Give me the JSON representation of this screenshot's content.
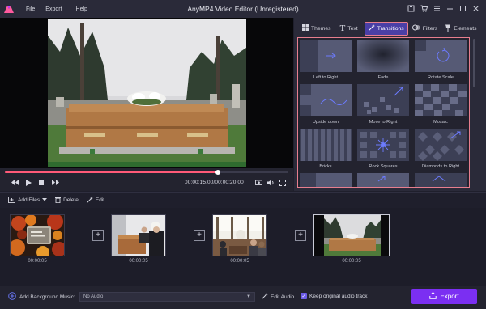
{
  "app": {
    "title": "AnyMP4 Video Editor (Unregistered)",
    "menu": [
      "File",
      "Export",
      "Help"
    ],
    "accent": "#7b2ff2",
    "highlight": "#e87e8e"
  },
  "player": {
    "progress": 0.75,
    "time_current": "00:00:15.00",
    "time_total": "00:00:20.00"
  },
  "tabs": [
    {
      "label": "Themes",
      "icon": "themes-grid-icon"
    },
    {
      "label": "Text",
      "icon": "text-t-icon"
    },
    {
      "label": "Transitions",
      "icon": "transitions-wand-icon",
      "active": true
    },
    {
      "label": "Filters",
      "icon": "filters-circles-icon"
    },
    {
      "label": "Elements",
      "icon": "elements-pin-icon"
    }
  ],
  "transitions": [
    {
      "label": "Left to Right"
    },
    {
      "label": "Fade"
    },
    {
      "label": "Rotate Scale"
    },
    {
      "label": "Upside down"
    },
    {
      "label": "Move to Right"
    },
    {
      "label": "Mosaic"
    },
    {
      "label": "Bricks"
    },
    {
      "label": "Rock Squares"
    },
    {
      "label": "Diamonds to Right"
    }
  ],
  "toolbar": {
    "add_files": "Add Files",
    "delete": "Delete",
    "edit": "Edit"
  },
  "timeline": {
    "clips": [
      {
        "duration": "00:00:05"
      },
      {
        "duration": "00:00:05"
      },
      {
        "duration": "00:00:05"
      },
      {
        "duration": "00:00:05",
        "selected": true
      }
    ]
  },
  "bottom": {
    "bg_music_label": "Add Background Music:",
    "audio_value": "No Audio",
    "edit_audio": "Edit Audio",
    "keep_audio": "Keep original audio track",
    "keep_audio_checked": true,
    "export": "Export"
  }
}
